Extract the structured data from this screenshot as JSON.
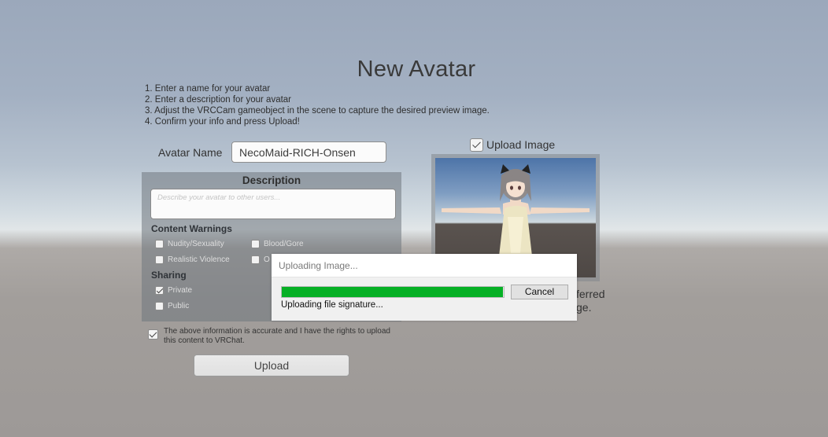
{
  "page": {
    "title": "New Avatar"
  },
  "instructions": [
    "1. Enter a name for your avatar",
    "2. Enter a description for your avatar",
    "3. Adjust the VRCCam gameobject in the scene to capture the desired preview image.",
    "4. Confirm your info and press Upload!"
  ],
  "avatar_name": {
    "label": "Avatar Name",
    "value": "NecoMaid-RICH-Onsen"
  },
  "description": {
    "title": "Description",
    "placeholder": "Describe your avatar to other users..."
  },
  "content_warnings": {
    "title": "Content Warnings",
    "items": [
      {
        "label": "Nudity/Sexuality",
        "checked": false
      },
      {
        "label": "Blood/Gore",
        "checked": false
      },
      {
        "label": "Realistic Violence",
        "checked": false
      },
      {
        "label": "O",
        "checked": false
      }
    ]
  },
  "sharing": {
    "title": "Sharing",
    "items": [
      {
        "label": "Private",
        "checked": true
      },
      {
        "label": "Public",
        "checked": false
      }
    ]
  },
  "agreement": {
    "text": "The above information is accurate and I have the rights to upload this content to VRChat.",
    "checked": true
  },
  "upload_button": {
    "label": "Upload"
  },
  "upload_image": {
    "label": "Upload Image",
    "checked": true
  },
  "preview_partial": {
    "line1": "ferred",
    "line2": "ge."
  },
  "dialog": {
    "title": "Uploading Image...",
    "progress": 0.995,
    "status": "Uploading file signature...",
    "cancel_label": "Cancel",
    "progress_color": "#06b025"
  },
  "icons": [
    "checkbox-icon",
    "check-icon"
  ]
}
